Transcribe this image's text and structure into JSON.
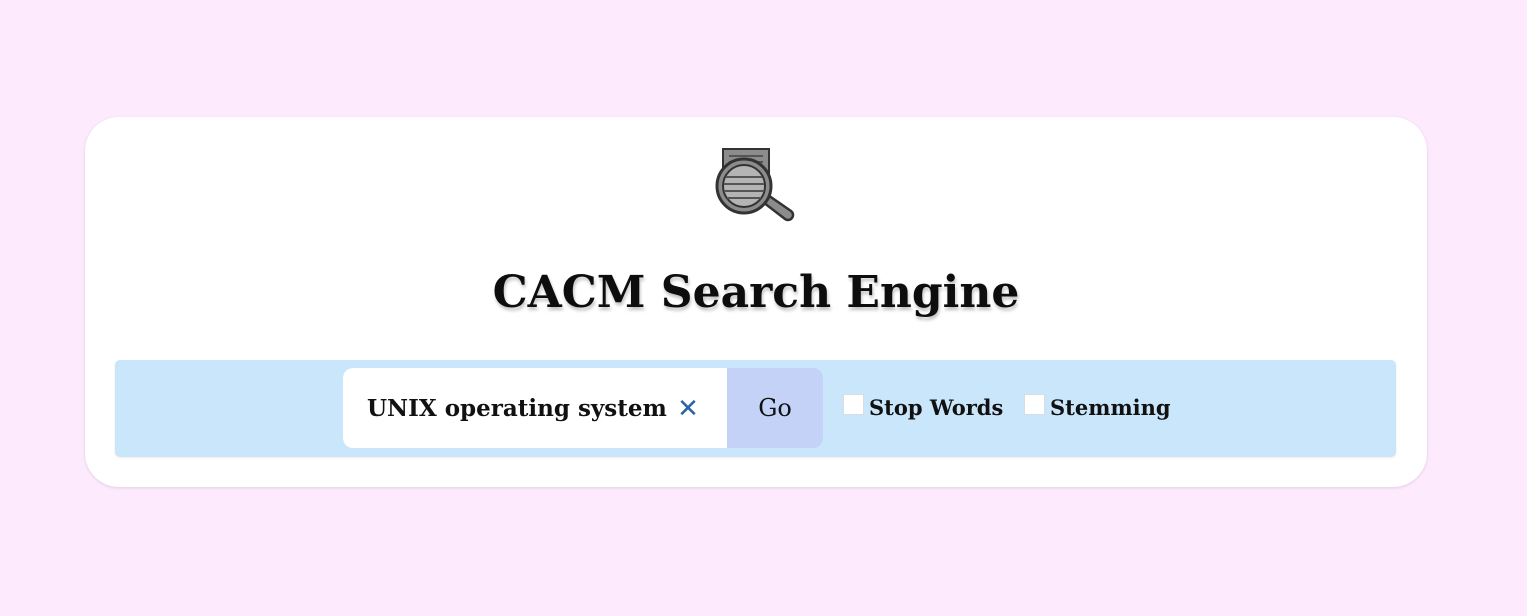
{
  "header": {
    "title": "CACM Search Engine",
    "logo_icon": "document-magnifier-icon"
  },
  "search": {
    "query": "UNIX operating system",
    "clear_icon": "close-icon",
    "clear_symbol": "✕",
    "go_label": "Go"
  },
  "options": {
    "stop_words": {
      "label": "Stop Words",
      "checked": false
    },
    "stemming": {
      "label": "Stemming",
      "checked": false
    }
  },
  "colors": {
    "page_background": "#fdebfd",
    "search_bar_background": "#c9e6fb",
    "go_button_background": "#c4d2f8",
    "clear_icon_color": "#2b63a4"
  }
}
